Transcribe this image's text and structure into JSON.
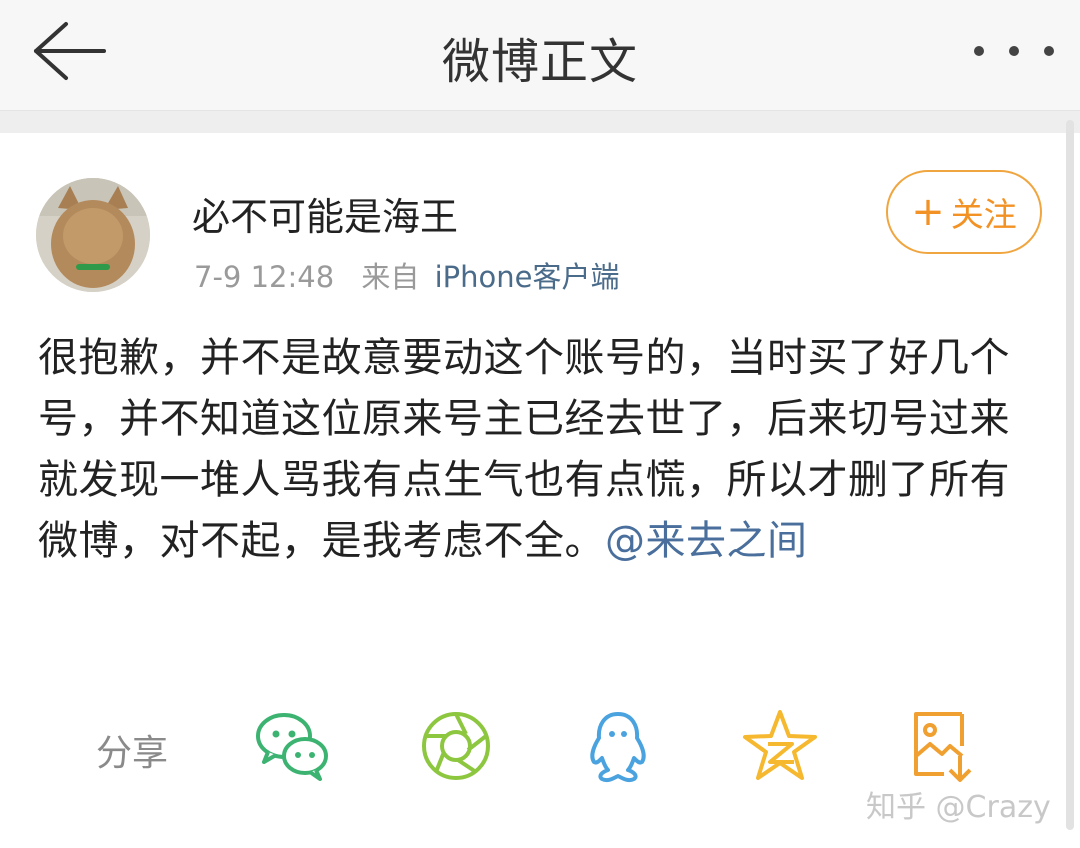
{
  "header": {
    "title": "微博正文",
    "back_icon": "back-arrow-icon",
    "more_icon": "more-dots-icon"
  },
  "post": {
    "username": "必不可能是海王",
    "time": "7-9 12:48",
    "source_prefix": "来自",
    "source": "iPhone客户端",
    "follow_label": "关注",
    "follow_plus": "+",
    "text": "很抱歉，并不是故意要动这个账号的，当时买了好几个号，并不知道这位原来号主已经去世了，后来切号过来就发现一堆人骂我有点生气也有点慌，所以才删了所有微博，对不起，是我考虑不全。",
    "mention": "@来去之间"
  },
  "share": {
    "label": "分享",
    "icons": [
      "wechat-icon",
      "moments-icon",
      "qq-icon",
      "qzone-icon",
      "save-image-icon"
    ]
  },
  "watermark": "知乎 @Crazy",
  "colors": {
    "follow_orange": "#f29225",
    "mention_blue": "#4a6f9c",
    "wechat_green": "#3cb371",
    "moments_green": "#8dc63f",
    "qq_blue": "#4aa3df",
    "qzone_yellow": "#f5b82e",
    "save_orange": "#f0a030"
  }
}
